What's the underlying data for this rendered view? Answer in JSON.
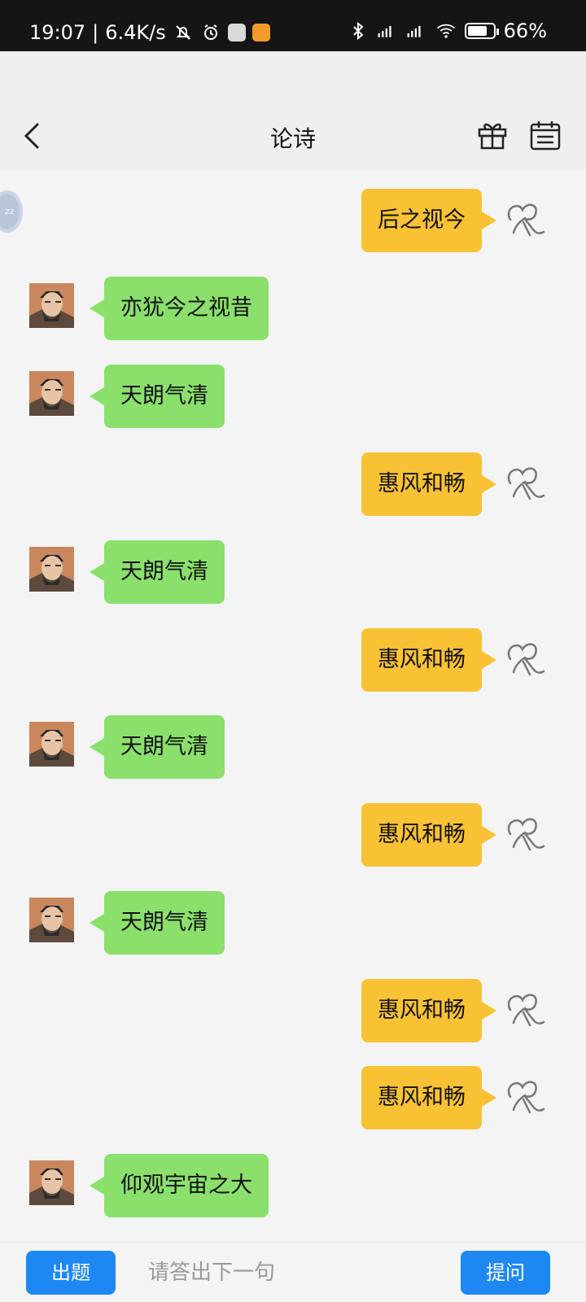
{
  "status_bar": {
    "time": "19:07",
    "separator": "|",
    "speed": "6.4K/s",
    "battery": "66%",
    "battery_level": 0.66
  },
  "header": {
    "title": "论诗",
    "back_icon": "chevron-left-icon",
    "gift_icon": "gift-icon",
    "calendar_icon": "calendar-icon"
  },
  "messages": [
    {
      "side": "right",
      "text": "后之视今"
    },
    {
      "side": "left",
      "text": "亦犹今之视昔"
    },
    {
      "side": "left",
      "text": "天朗气清"
    },
    {
      "side": "right",
      "text": "惠风和畅"
    },
    {
      "side": "left",
      "text": "天朗气清"
    },
    {
      "side": "right",
      "text": "惠风和畅"
    },
    {
      "side": "left",
      "text": "天朗气清"
    },
    {
      "side": "right",
      "text": "惠风和畅"
    },
    {
      "side": "left",
      "text": "天朗气清"
    },
    {
      "side": "right",
      "text": "惠风和畅"
    },
    {
      "side": "right",
      "text": "惠风和畅"
    },
    {
      "side": "left",
      "text": "仰观宇宙之大"
    }
  ],
  "footer": {
    "left_button": "出题",
    "input_placeholder": "请答出下一句",
    "right_button": "提问"
  },
  "colors": {
    "left_bubble": "#8ae06b",
    "right_bubble": "#f8c234",
    "button": "#1e88f2"
  }
}
